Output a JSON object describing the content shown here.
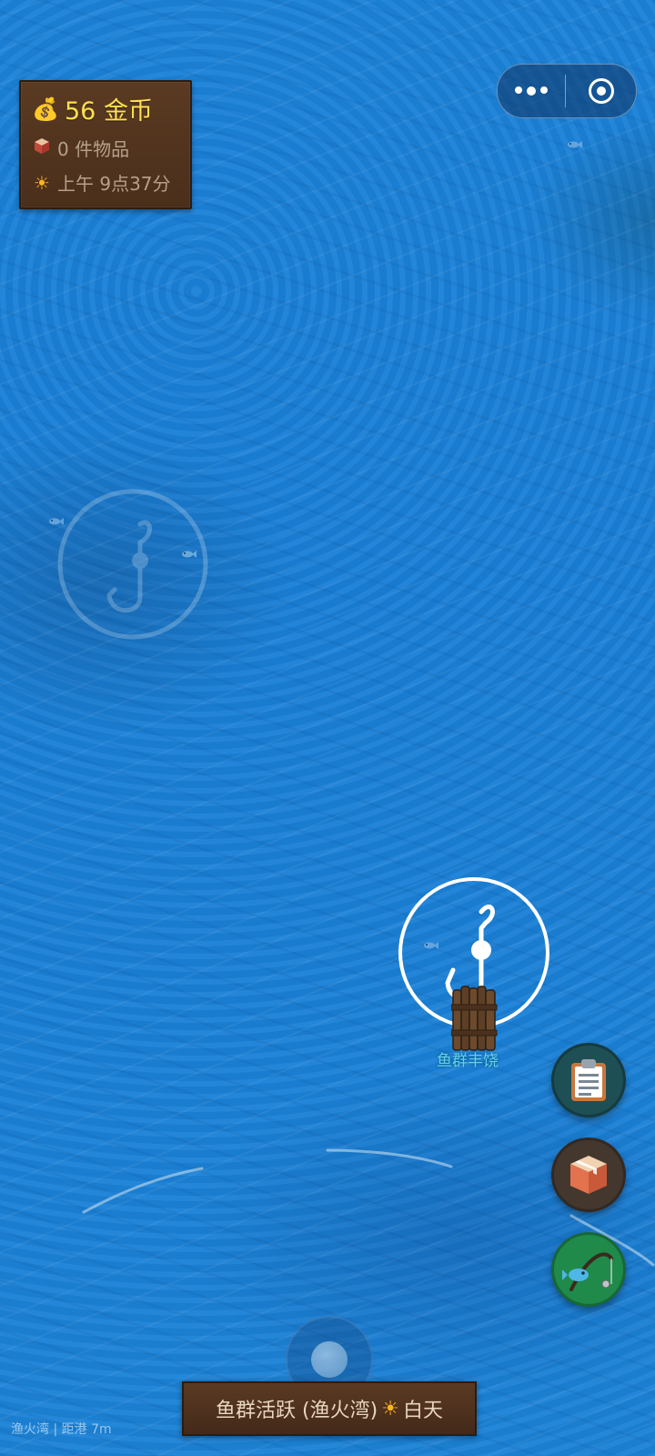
{
  "status": {
    "gold": "56 金币",
    "items": "0 件物品",
    "time": "上午 9点37分"
  },
  "fishing_spot": {
    "label": "鱼群丰饶"
  },
  "banner": {
    "event": "鱼群活跃 (渔火湾)",
    "phase": "白天"
  },
  "location": "渔火湾 | 距港 7m",
  "icons": {
    "gold": "money-bag-icon",
    "items": "box-icon",
    "time": "sun-icon",
    "tasks": "clipboard-icon",
    "inventory": "package-icon",
    "fish": "fishing-rod-icon"
  },
  "colors": {
    "gold_text": "#ffe050",
    "panel_wood": "#5a3a22",
    "spot_label": "#5fd3e6",
    "tasks_button": "#1d4f55",
    "inventory_button": "#44372e",
    "fish_button": "#1f8a4a"
  }
}
